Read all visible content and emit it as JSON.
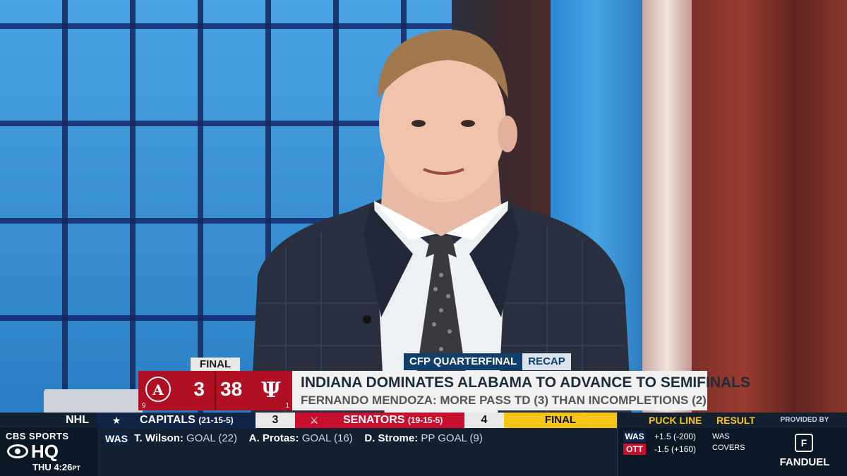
{
  "lower_third": {
    "final_tab": "FINAL",
    "team_a": {
      "score": "3",
      "seed": "9",
      "logo": "alabama-logo"
    },
    "team_b": {
      "score": "38",
      "seed": "1",
      "logo": "indiana-logo"
    },
    "tag_left": "CFP QUARTERFINAL",
    "tag_right": "RECAP",
    "headline": "INDIANA DOMINATES ALABAMA TO ADVANCE TO SEMIFINALS",
    "subline": "FERNANDO MENDOZA: MORE PASS TD (3) THAN INCOMPLETIONS (2)",
    "colors": {
      "alabama": "#b00f24",
      "headline_bg": "#f1f1f1",
      "tag_dark": "#0f3f6a"
    }
  },
  "ticker": {
    "league": "NHL",
    "brand_top": "CBS SPORTS",
    "brand_hq": "HQ",
    "clock": "THU 4:26",
    "clock_tz": "PT",
    "game": {
      "home": {
        "name": "CAPITALS",
        "record": "(21-15-5)",
        "score": "3",
        "icon": "capitals-logo"
      },
      "away": {
        "name": "SENATORS",
        "record": "(19-15-5)",
        "score": "4",
        "icon": "senators-logo"
      },
      "status": "FINAL"
    },
    "scorers_team": "WAS",
    "scorers": [
      {
        "name": "T. Wilson:",
        "event": "GOAL (22)"
      },
      {
        "name": "A. Protas:",
        "event": "GOAL (16)"
      },
      {
        "name": "D. Strome:",
        "event": "PP GOAL (9)"
      }
    ],
    "odds": {
      "header_line": "PUCK LINE",
      "header_result": "RESULT",
      "rows": [
        {
          "team": "WAS",
          "line": "+1.5 (-200)",
          "result": "WAS COVERS",
          "color": "#0f2447"
        },
        {
          "team": "OTT",
          "line": "-1.5 (+160)",
          "result": "-",
          "color": "#c8102e"
        }
      ]
    },
    "sponsor": {
      "provided_by": "PROVIDED BY",
      "name": "FANDUEL"
    }
  }
}
